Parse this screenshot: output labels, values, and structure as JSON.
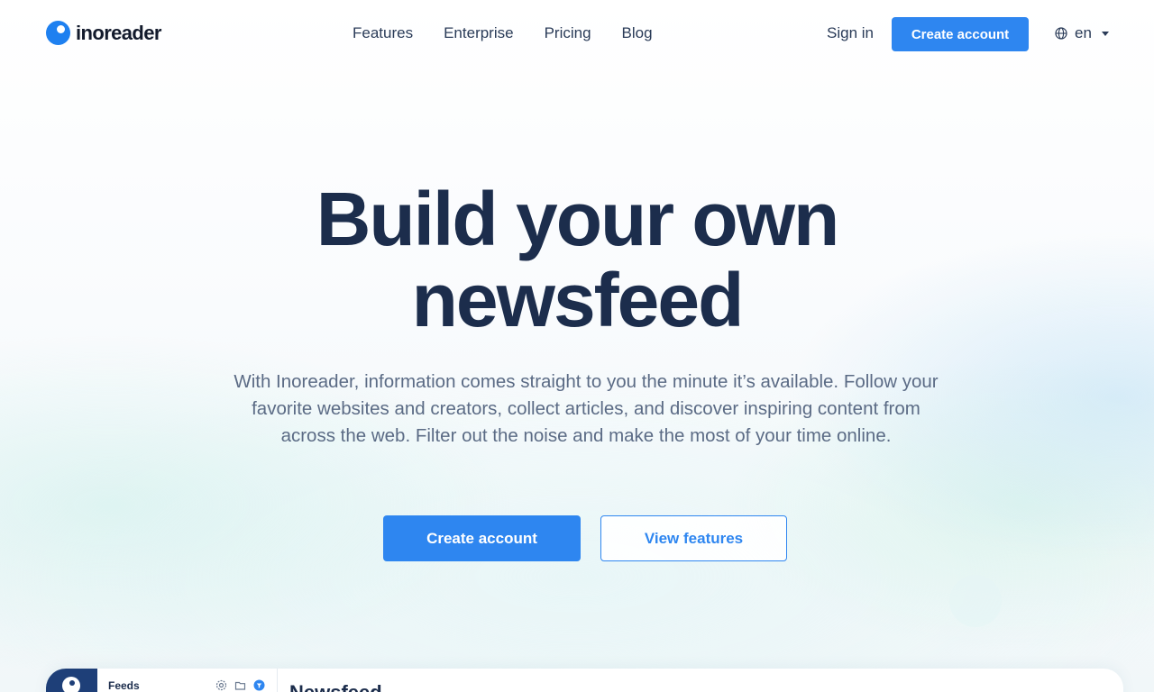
{
  "header": {
    "logo_text": "inoreader",
    "nav": [
      {
        "label": "Features"
      },
      {
        "label": "Enterprise"
      },
      {
        "label": "Pricing"
      },
      {
        "label": "Blog"
      }
    ],
    "sign_in": "Sign in",
    "create_account": "Create account",
    "language": "en"
  },
  "hero": {
    "title_line1": "Build your own",
    "title_line2": "newsfeed",
    "subtitle": "With Inoreader, information comes straight to you the minute it’s available. Follow your favorite websites and creators, collect articles, and discover inspiring content from across the web. Filter out the noise and make the most of your time online.",
    "primary_button": "Create account",
    "secondary_button": "View features"
  },
  "preview": {
    "sidebar_title": "Feeds",
    "main_title": "Newsfeed"
  },
  "colors": {
    "accent": "#2e86f0",
    "heading": "#1c2d4c",
    "body_text": "#5b6b85",
    "rail": "#1e3f78"
  },
  "icons": [
    "globe-icon",
    "chevron-down-icon",
    "settings-icon",
    "folder-icon",
    "filter-icon"
  ]
}
